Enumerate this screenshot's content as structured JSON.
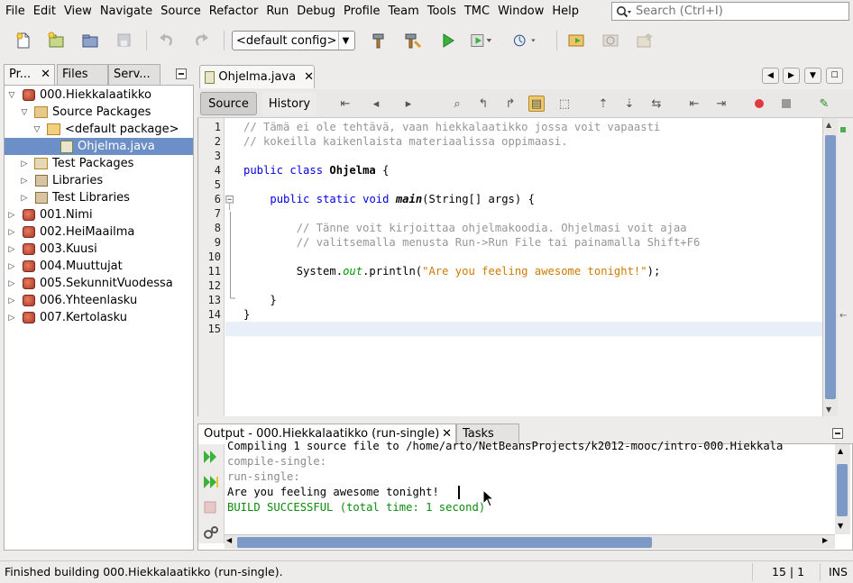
{
  "menu": [
    "File",
    "Edit",
    "View",
    "Navigate",
    "Source",
    "Refactor",
    "Run",
    "Debug",
    "Profile",
    "Team",
    "Tools",
    "TMC",
    "Window",
    "Help"
  ],
  "search": {
    "placeholder": "Search (Ctrl+I)"
  },
  "toolbar": {
    "config": "<default config>"
  },
  "left_panel": {
    "tabs": [
      "Pr...",
      "Files",
      "Serv..."
    ],
    "tree": [
      {
        "label": "000.Hiekkalaatikko",
        "icon": "project-icon",
        "indent": 0,
        "expanded": true
      },
      {
        "label": "Source Packages",
        "icon": "source-packages-icon",
        "indent": 1,
        "expanded": true
      },
      {
        "label": "<default package>",
        "icon": "package-icon",
        "indent": 2,
        "expanded": true
      },
      {
        "label": "Ohjelma.java",
        "icon": "java-file-icon",
        "indent": 3,
        "selected": true
      },
      {
        "label": "Test Packages",
        "icon": "test-packages-icon",
        "indent": 1,
        "expanded": false
      },
      {
        "label": "Libraries",
        "icon": "libraries-icon",
        "indent": 1,
        "expanded": false
      },
      {
        "label": "Test Libraries",
        "icon": "test-libraries-icon",
        "indent": 1,
        "expanded": false
      },
      {
        "label": "001.Nimi",
        "icon": "project-icon",
        "indent": 0,
        "expanded": false
      },
      {
        "label": "002.HeiMaailma",
        "icon": "project-icon",
        "indent": 0,
        "expanded": false
      },
      {
        "label": "003.Kuusi",
        "icon": "project-icon",
        "indent": 0,
        "expanded": false
      },
      {
        "label": "004.Muuttujat",
        "icon": "project-icon",
        "indent": 0,
        "expanded": false
      },
      {
        "label": "005.SekunnitVuodessa",
        "icon": "project-icon",
        "indent": 0,
        "expanded": false
      },
      {
        "label": "006.Yhteenlasku",
        "icon": "project-icon",
        "indent": 0,
        "expanded": false
      },
      {
        "label": "007.Kertolasku",
        "icon": "project-icon",
        "indent": 0,
        "expanded": false
      }
    ]
  },
  "editor": {
    "tab_label": "Ohjelma.java",
    "mode_source": "Source",
    "mode_history": "History",
    "lines": [
      {
        "n": "1",
        "t": "// Tämä ei ole tehtävä, vaan hiekkalaatikko jossa voit vapaasti"
      },
      {
        "n": "2",
        "t": "// kokeilla kaikenlaista materiaalissa oppimaasi."
      },
      {
        "n": "3",
        "t": ""
      },
      {
        "n": "4",
        "t": "public class Ohjelma {"
      },
      {
        "n": "5",
        "t": ""
      },
      {
        "n": "6",
        "t": "    public static void main(String[] args) {"
      },
      {
        "n": "7",
        "t": ""
      },
      {
        "n": "8",
        "t": "        // Tänne voit kirjoittaa ohjelmakoodia. Ohjelmasi voit ajaa"
      },
      {
        "n": "9",
        "t": "        // valitsemalla menusta Run->Run File tai painamalla Shift+F6"
      },
      {
        "n": "10",
        "t": ""
      },
      {
        "n": "11",
        "t": "        System.out.println(\"Are you feeling awesome tonight!\");"
      },
      {
        "n": "12",
        "t": ""
      },
      {
        "n": "13",
        "t": "    }"
      },
      {
        "n": "14",
        "t": "}"
      },
      {
        "n": "15",
        "t": ""
      }
    ]
  },
  "output": {
    "tab_label": "Output - 000.Hiekkalaatikko (run-single)",
    "tasks_label": "Tasks",
    "lines": [
      {
        "t": "Compiling 1 source file to /home/arto/NetBeansProjects/k2012-mooc/intro-000.Hiekkala",
        "cls": ""
      },
      {
        "t": "compile-single:",
        "cls": "out-gray"
      },
      {
        "t": "run-single:",
        "cls": "out-gray"
      },
      {
        "t": "Are you feeling awesome tonight!",
        "cls": ""
      },
      {
        "t": "BUILD SUCCESSFUL (total time: 1 second)",
        "cls": "out-green"
      }
    ]
  },
  "status": {
    "message": "Finished building 000.Hiekkalaatikko (run-single).",
    "position": "15 | 1",
    "mode": "INS"
  },
  "colors": {
    "selection": "#6d8fc7",
    "scroll_thumb": "#7d99c6",
    "keyword": "#0000e6",
    "string": "#ce7b00",
    "success": "#0b8a0b"
  }
}
